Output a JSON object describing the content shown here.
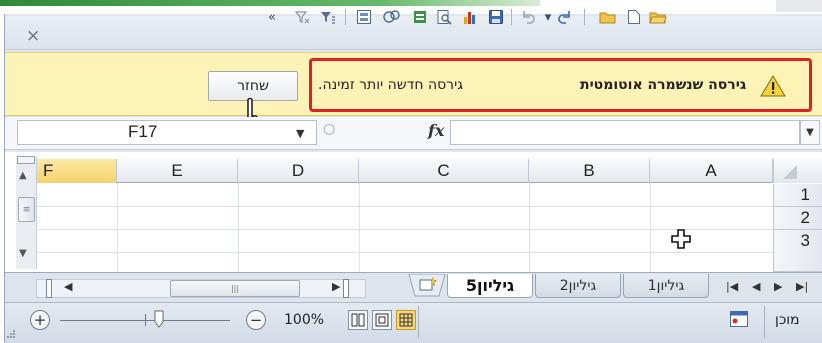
{
  "quick_access_toolbar": {
    "icons": [
      "more-icon",
      "clear-filter-icon",
      "filter-icon",
      "form-icon",
      "shapes-icon",
      "spelling-icon",
      "print-preview-icon",
      "chart-icon",
      "save-icon",
      "undo-icon",
      "redo-icon",
      "open-icon",
      "new-icon",
      "folder-icon"
    ]
  },
  "message_bar": {
    "close_glyph": "×",
    "title": "גירסה שנשמרה אוטומטית",
    "text": "גירסה חדשה יותר זמינה.",
    "restore_label": "שחזר"
  },
  "formula_bar": {
    "name_box": "F17",
    "fx_label": "fx",
    "formula_value": ""
  },
  "grid": {
    "columns": [
      "F",
      "E",
      "D",
      "C",
      "B",
      "A"
    ],
    "active_column": "F",
    "rows": [
      "1",
      "2",
      "3"
    ]
  },
  "sheet_tabs": {
    "tabs": [
      "גיליון5",
      "גיליון2",
      "גיליון1"
    ],
    "active_tab": "גיליון5"
  },
  "status_bar": {
    "zoom_level": "100%",
    "status": "מוכן",
    "view_active": "page-break-preview"
  },
  "colors": {
    "message_bar_bg": "#fdf3b6",
    "highlight_border": "#e02025",
    "active_header": "#f5d36b"
  }
}
